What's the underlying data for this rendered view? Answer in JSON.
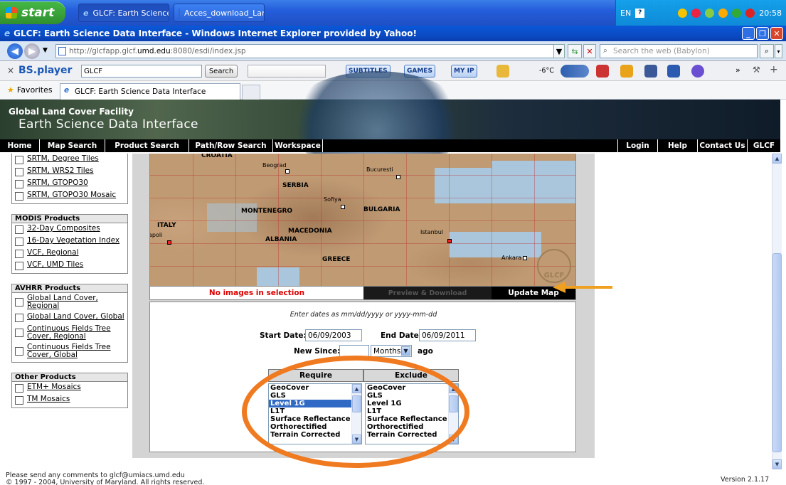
{
  "taskbar": {
    "start_label": "start",
    "buttons": [
      "GLCF: Earth Science ...",
      "Acces_download_Lan..."
    ],
    "tray": {
      "language": "EN",
      "clock": "20:58"
    }
  },
  "window": {
    "title": "GLCF: Earth Science Data Interface - Windows Internet Explorer provided by Yahoo!"
  },
  "addressbar": {
    "url_prefix": "http://glcfapp.glcf.",
    "url_domain": "umd.edu",
    "url_suffix": ":8080/esdi/index.jsp",
    "search_placeholder": "Search the web (Babylon)"
  },
  "bsplayer": {
    "logo": "BS.player",
    "search_value": "GLCF",
    "search_button": "Search",
    "chips": [
      "SUBTITLES",
      "GAMES",
      "MY IP"
    ],
    "temperature": "-6°C"
  },
  "favorites": {
    "label": "Favorites",
    "tab_title": "GLCF: Earth Science Data Interface"
  },
  "banner": {
    "line1": "Global Land Cover Facility",
    "line2": "Earth Science Data Interface"
  },
  "nav": {
    "left": [
      "Home",
      "Map Search",
      "Product Search",
      "Path/Row Search",
      "Workspace"
    ],
    "right": [
      "Login",
      "Help",
      "Contact Us",
      "GLCF"
    ]
  },
  "sidebar": {
    "srtm_items": [
      "SRTM, Degree Tiles",
      "SRTM, WRS2 Tiles",
      "SRTM, GTOPO30",
      "SRTM, GTOPO30 Mosaic"
    ],
    "modis": {
      "title": "MODIS Products",
      "items": [
        "32-Day Composites",
        "16-Day Vegetation Index",
        "VCF, Regional",
        "VCF, UMD Tiles"
      ]
    },
    "avhrr": {
      "title": "AVHRR Products",
      "items": [
        "Global Land Cover, Regional",
        "Global Land Cover, Global",
        "Continuous Fields Tree Cover, Regional",
        "Continuous Fields Tree Cover, Global"
      ]
    },
    "other": {
      "title": "Other Products",
      "items": [
        "ETM+ Mosaics",
        "TM Mosaics"
      ]
    }
  },
  "map": {
    "countries": [
      "CROATIA",
      "SERBIA",
      "BULGARIA",
      "MONTENEGRO",
      "MACEDONIA",
      "ALBANIA",
      "ITALY",
      "GREECE"
    ],
    "cities": [
      "Beograd",
      "Bucuresti",
      "Sofiya",
      "Istanbul",
      "Ankara",
      "apoli"
    ],
    "logo": "GLCF"
  },
  "status": {
    "message": "No images in selection",
    "preview_button": "Preview & Download",
    "update_button": "Update Map"
  },
  "form": {
    "hint": "Enter dates as mm/dd/yyyy or yyyy-mm-dd",
    "start_label": "Start Date:",
    "start_value": "06/09/2003",
    "end_label": "End Date:",
    "end_value": "06/09/2011",
    "new_since_label": "New Since:",
    "new_since_value": "",
    "unit_value": "Months",
    "ago_label": "ago",
    "require_header": "Require",
    "exclude_header": "Exclude",
    "options": [
      "GeoCover",
      "GLS",
      "Level 1G",
      "L1T",
      "Surface Reflectance",
      "Orthorectified",
      "Terrain Corrected"
    ],
    "require_selected_index": 2
  },
  "footer": {
    "line1": "Please send any comments to glcf@umiacs.umd.edu",
    "line2": "© 1997 - 2004, University of Maryland. All rights reserved.",
    "version": "Version 2.1.17"
  },
  "colors": {
    "highlight": "#f07a20",
    "selection": "#316ac5",
    "warning_text": "#dd0000"
  }
}
